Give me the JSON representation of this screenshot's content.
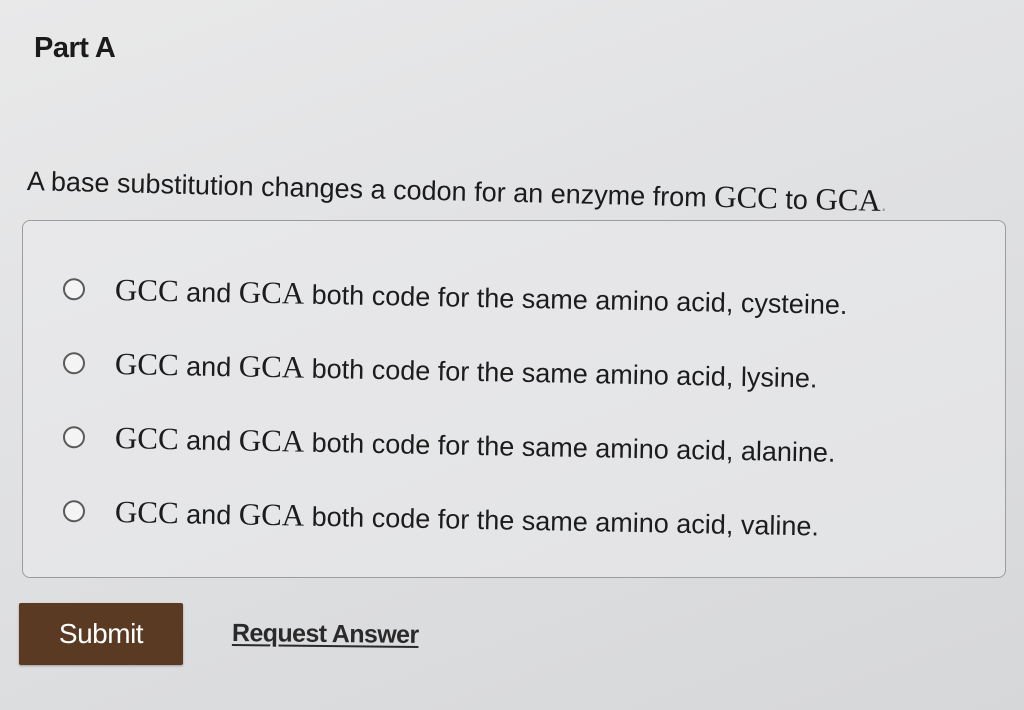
{
  "part": {
    "title": "Part A"
  },
  "question": {
    "prefix": "A base substitution changes a codon for an enzyme from ",
    "codon_from": "GCC",
    "middle": " to ",
    "codon_to": "GCA",
    "suffix": "."
  },
  "options": [
    {
      "codon_a": "GCC",
      "and": " and ",
      "codon_b": "GCA",
      "text": " both code for the same amino acid, cysteine."
    },
    {
      "codon_a": "GCC",
      "and": " and ",
      "codon_b": "GCA",
      "text": " both code for the same amino acid, lysine."
    },
    {
      "codon_a": "GCC",
      "and": " and ",
      "codon_b": "GCA",
      "text": " both code for the same amino acid, alanine."
    },
    {
      "codon_a": "GCC",
      "and": " and ",
      "codon_b": "GCA",
      "text": " both code for the same amino acid, valine."
    }
  ],
  "actions": {
    "submit_label": "Submit",
    "request_answer_label": "Request Answer"
  },
  "colors": {
    "submit_bg": "#5a3a22",
    "page_bg": "#e4e4e5"
  }
}
